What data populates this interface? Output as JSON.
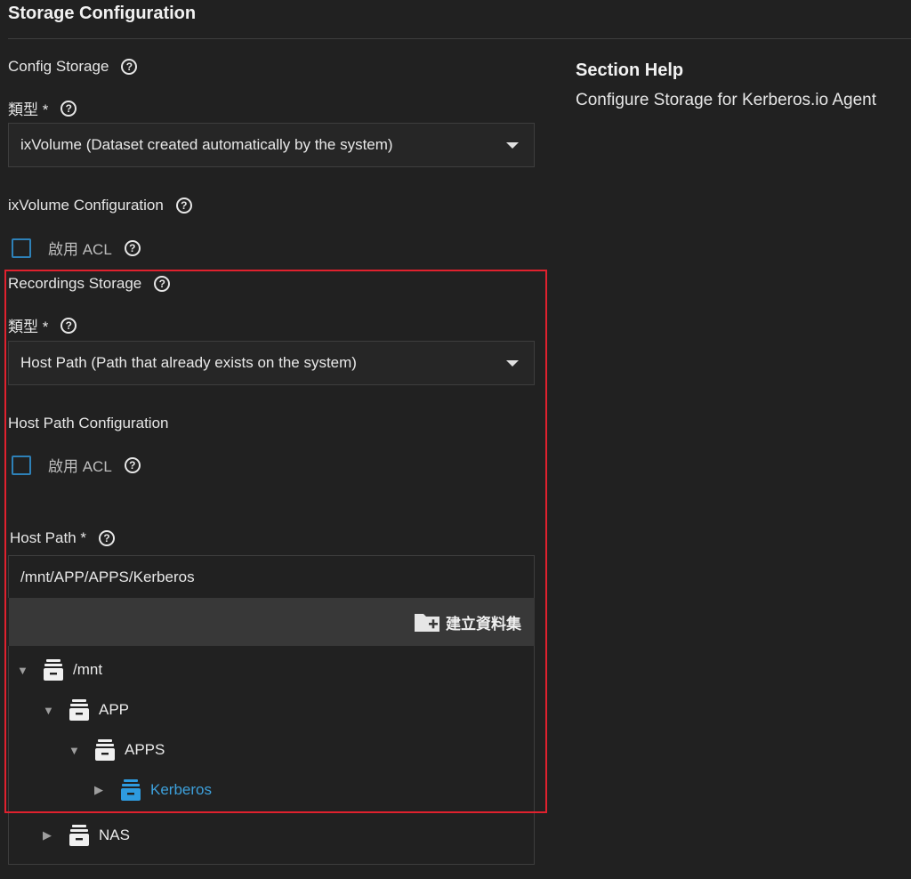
{
  "page": {
    "title": "Storage Configuration"
  },
  "config_storage": {
    "label": "Config Storage",
    "type_label": "類型 *",
    "type_value": "ixVolume (Dataset created automatically by the system)",
    "ixvolume_config_label": "ixVolume Configuration",
    "acl_label": "啟用 ACL",
    "acl_checked": false
  },
  "recordings_storage": {
    "label": "Recordings Storage",
    "type_label": "類型 *",
    "type_value": "Host Path (Path that already exists on the system)",
    "host_path_config_label": "Host Path Configuration",
    "acl_label": "啟用 ACL",
    "acl_checked": false,
    "host_path_label": "Host Path *",
    "host_path_value": "/mnt/APP/APPS/Kerberos",
    "create_dataset_label": "建立資料集",
    "tree": [
      {
        "label": "/mnt",
        "expanded": true,
        "icon": "dataset-icon"
      },
      {
        "label": "APP",
        "expanded": true,
        "icon": "dataset-icon"
      },
      {
        "label": "APPS",
        "expanded": true,
        "icon": "dataset-icon"
      },
      {
        "label": "Kerberos",
        "expanded": false,
        "selected": true,
        "icon": "dataset-icon"
      },
      {
        "label": "NAS",
        "expanded": false,
        "icon": "dataset-icon"
      }
    ]
  },
  "section_help": {
    "title": "Section Help",
    "text": "Configure Storage for Kerberos.io Agent"
  },
  "colors": {
    "background": "#212121",
    "accent": "#2e81b8",
    "selected_text": "#3da0db",
    "highlight_border": "#e0212e"
  }
}
